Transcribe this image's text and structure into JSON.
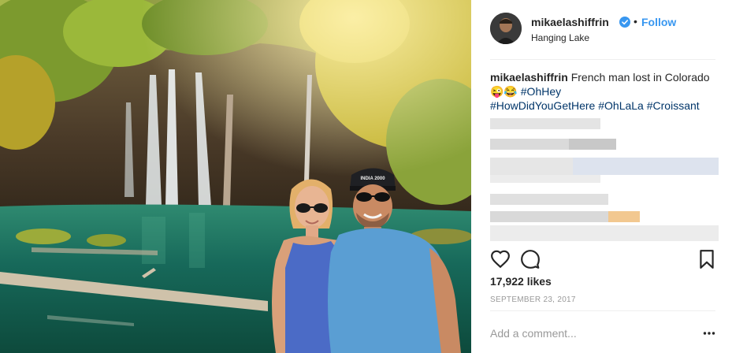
{
  "post": {
    "username": "mikaelashiffrin",
    "follow_label": "Follow",
    "dot_separator": "•",
    "location": "Hanging Lake",
    "caption": {
      "username": "mikaelashiffrin",
      "text": "French man lost in Colorado😜😂",
      "hashtags": [
        "#OhHey",
        "#HowDidYouGetHere",
        "#OhLaLa",
        "#Croissant"
      ]
    },
    "likes": "17,922 likes",
    "date": "SEPTEMBER 23, 2017",
    "comment_placeholder": "Add a comment..."
  },
  "photo": {
    "cap_text": "INDIA 2000",
    "description_icons": [
      "waterfall-scene",
      "couple-portrait"
    ]
  },
  "icons": {
    "verified": "verified-badge-icon",
    "like": "heart-icon",
    "comment": "comment-bubble-icon",
    "save": "bookmark-icon",
    "more": "more-options-icon"
  },
  "colors": {
    "follow": "#3897f0",
    "hashtag": "#003569",
    "muted": "#999999",
    "text": "#262626",
    "verified": "#3897f0"
  }
}
